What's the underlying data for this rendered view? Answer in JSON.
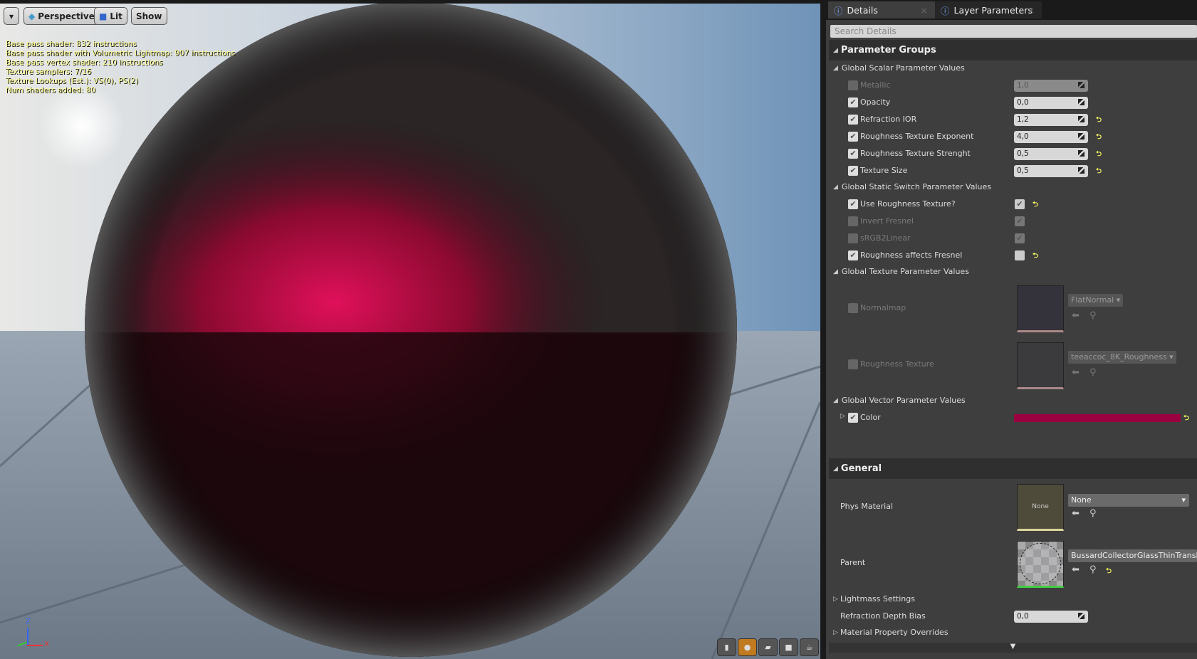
{
  "viewport": {
    "menu_icon": "chevron-down-icon",
    "perspective_label": "Perspective",
    "lit_label": "Lit",
    "show_label": "Show",
    "stats": [
      "Base pass shader: 832 instructions",
      "Base pass shader with Volumetric Lightmap: 907 instructions",
      "Base pass vertex shader: 210 instructions",
      "Texture samplers: 7/16",
      "Texture Lookups (Est.): VS(0), PS(2)",
      "Num shaders added: 80"
    ],
    "axis": {
      "z": "Z",
      "x": "X"
    },
    "preview_icons": [
      "cylinder-icon",
      "sphere-icon",
      "plane-icon",
      "cube-icon",
      "teapot-icon"
    ]
  },
  "panel": {
    "tabs": [
      {
        "label": "Details",
        "icon": "info-icon"
      },
      {
        "label": "Layer Parameters",
        "icon": "info-icon"
      }
    ],
    "search_placeholder": "Search Details",
    "parameter_groups": "Parameter Groups",
    "scalar_group": "Global Scalar Parameter Values",
    "scalars": [
      {
        "label": "Metallic",
        "enabled": false,
        "value": "1,0",
        "reset": false
      },
      {
        "label": "Opacity",
        "enabled": true,
        "value": "0,0",
        "reset": false
      },
      {
        "label": "Refraction IOR",
        "enabled": true,
        "value": "1,2",
        "reset": true
      },
      {
        "label": "Roughness Texture Exponent",
        "enabled": true,
        "value": "4,0",
        "reset": true
      },
      {
        "label": "Roughness Texture Strenght",
        "enabled": true,
        "value": "0,5",
        "reset": true
      },
      {
        "label": "Texture Size",
        "enabled": true,
        "value": "0,5",
        "reset": true
      }
    ],
    "switch_group": "Global Static Switch Parameter Values",
    "switches": [
      {
        "label": "Use Roughness Texture?",
        "enabled": true,
        "value": true,
        "reset": true
      },
      {
        "label": "Invert Fresnel",
        "enabled": false,
        "value": true,
        "reset": false
      },
      {
        "label": "sRGB2Linear",
        "enabled": false,
        "value": true,
        "reset": false
      },
      {
        "label": "Roughness affects Fresnel",
        "enabled": true,
        "value": false,
        "reset": true
      }
    ],
    "texture_group": "Global Texture Parameter Values",
    "textures": [
      {
        "label": "Normalmap",
        "asset": "FlatNormal"
      },
      {
        "label": "Roughness Texture",
        "asset": "teeaccoc_8K_Roughness"
      }
    ],
    "vector_group": "Global Vector Parameter Values",
    "color": {
      "label": "Color",
      "value": "#9a0040"
    },
    "general": "General",
    "phys_material": {
      "label": "Phys Material",
      "thumb": "None",
      "value": "None"
    },
    "parent": {
      "label": "Parent",
      "value": "BussardCollectorGlassThinTransluc"
    },
    "lightmass": "Lightmass Settings",
    "refraction_depth_bias": {
      "label": "Refraction Depth Bias",
      "value": "0,0"
    },
    "material_overrides": "Material Property Overrides"
  }
}
